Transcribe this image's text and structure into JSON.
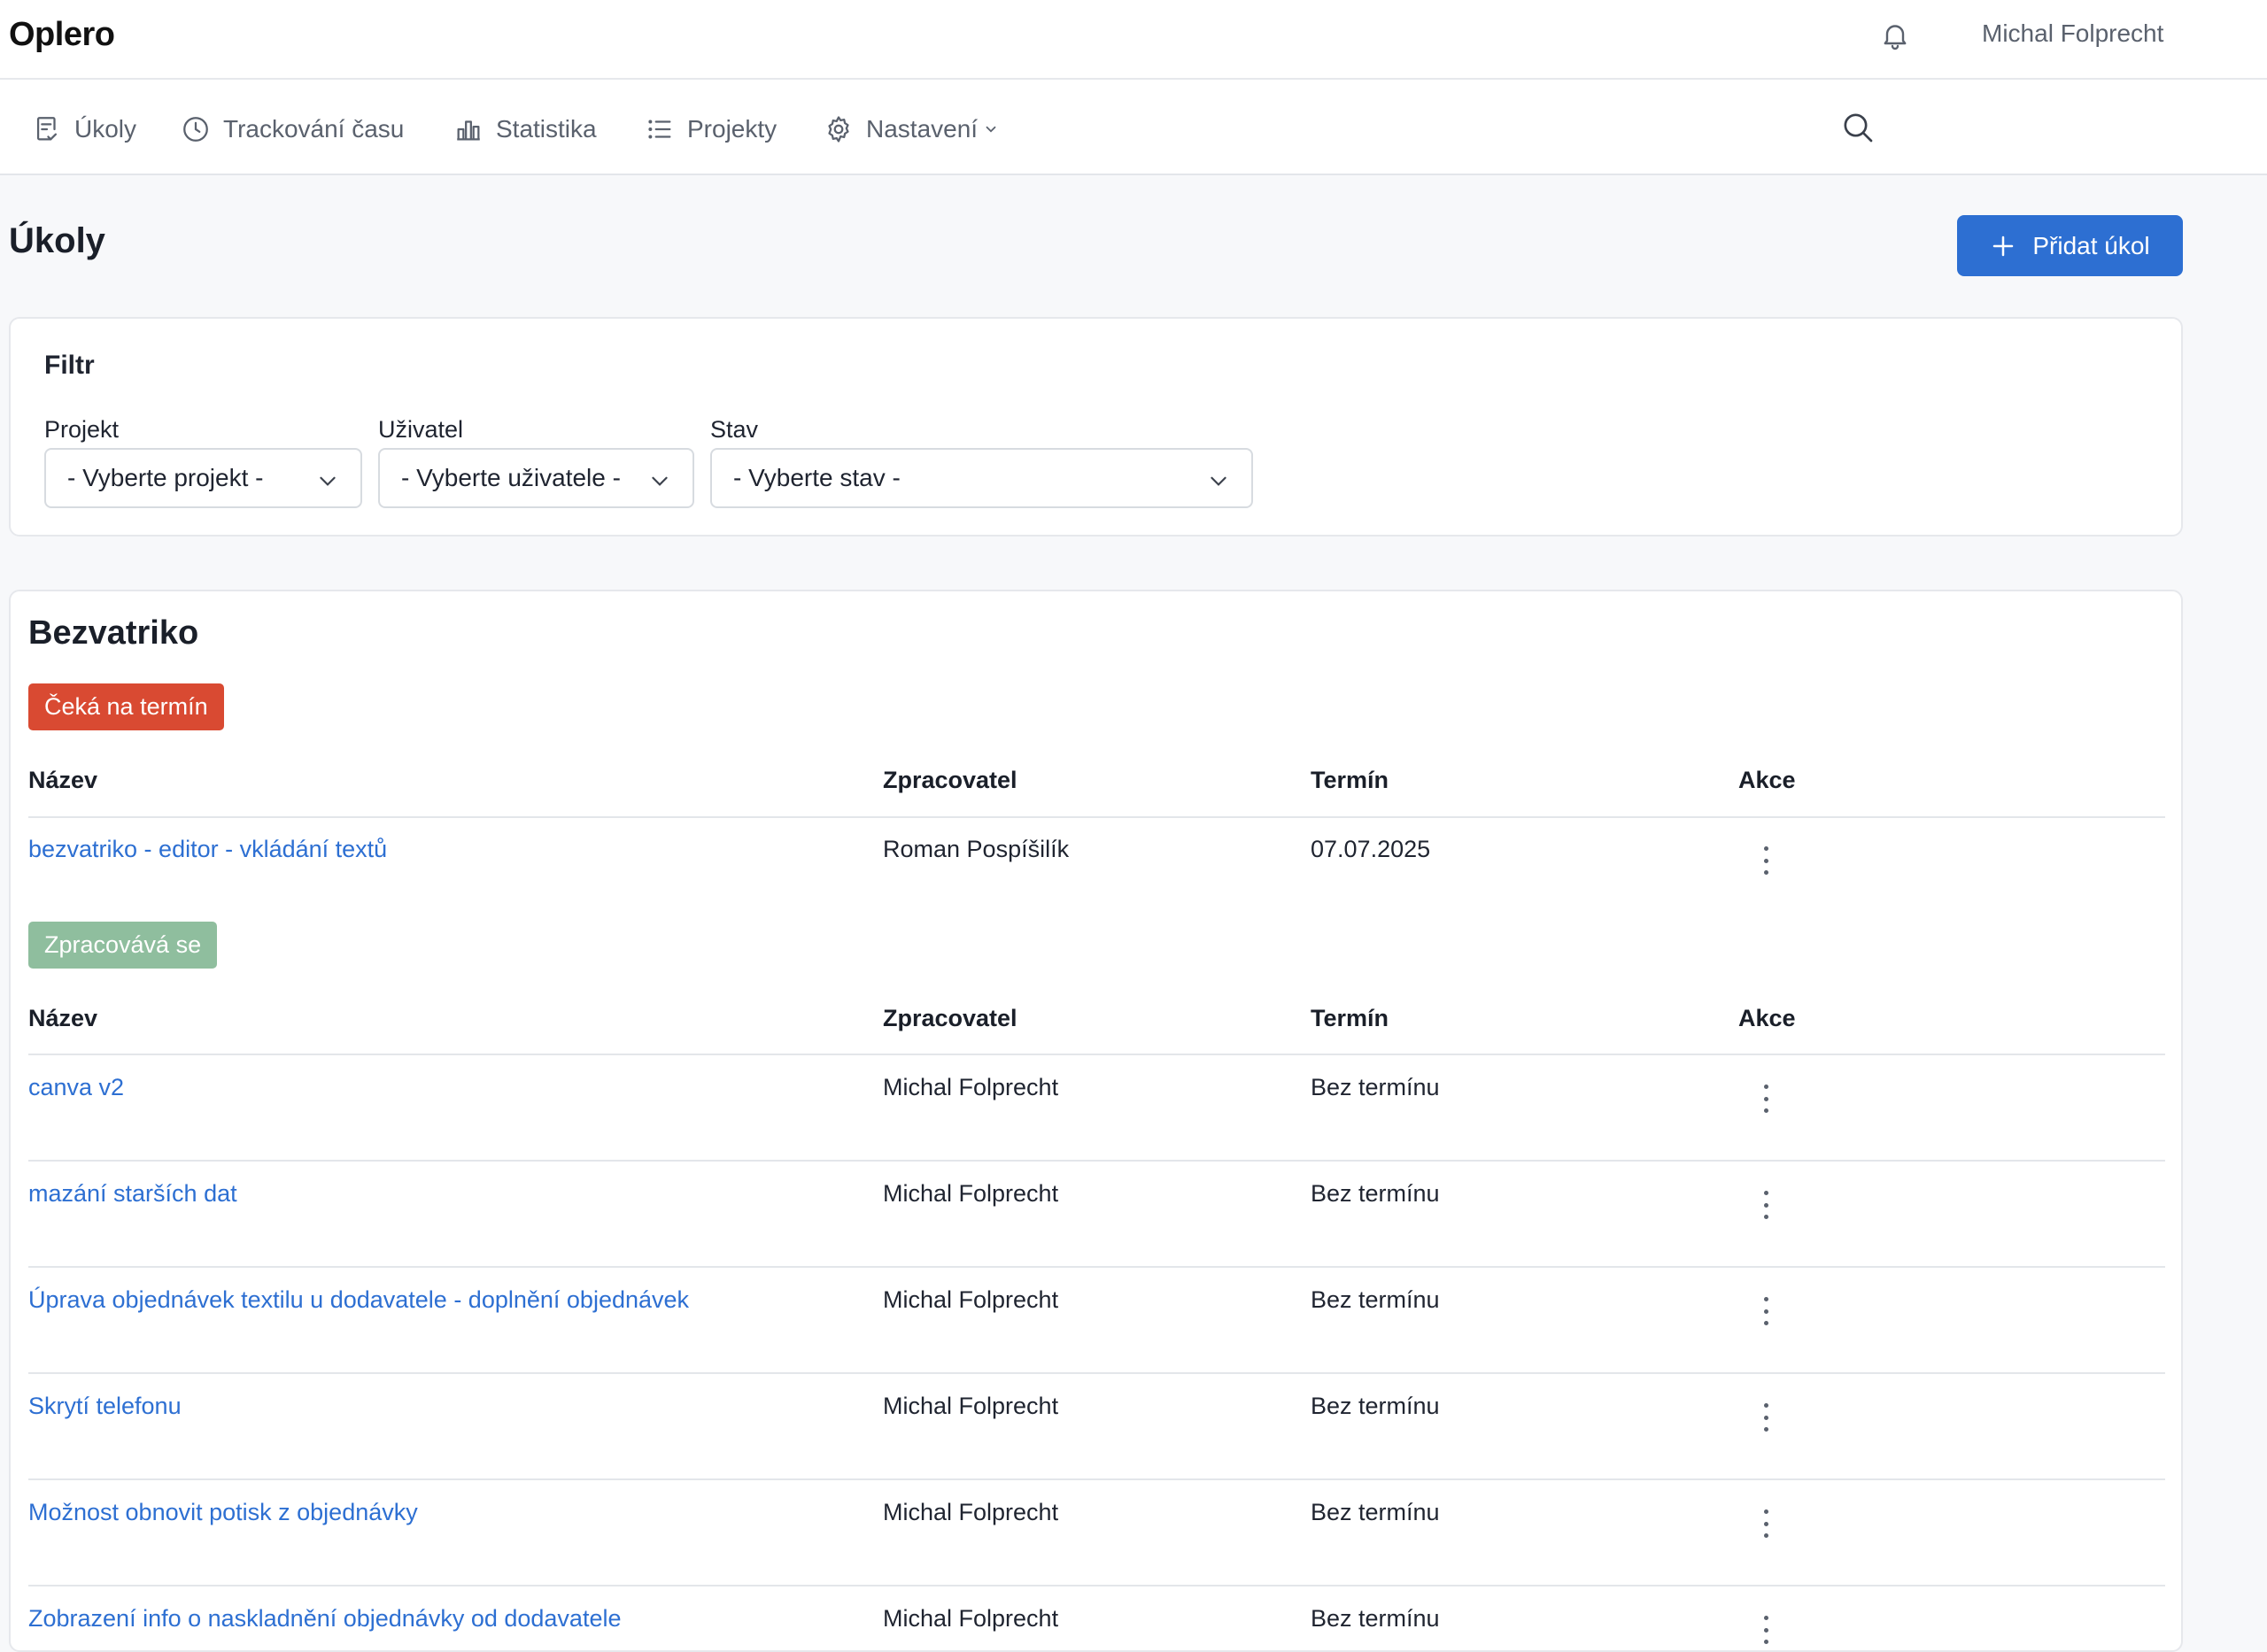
{
  "app": {
    "brand": "Oplero",
    "user_name": "Michal Folprecht"
  },
  "nav": {
    "items": [
      {
        "label": "Úkoly",
        "icon": "task-icon"
      },
      {
        "label": "Trackování času",
        "icon": "clock-icon"
      },
      {
        "label": "Statistika",
        "icon": "bar-chart-icon"
      },
      {
        "label": "Projekty",
        "icon": "list-icon"
      },
      {
        "label": "Nastavení",
        "icon": "gear-icon"
      }
    ]
  },
  "page": {
    "title": "Úkoly",
    "add_button": "Přidat úkol"
  },
  "filter": {
    "title": "Filtr",
    "project": {
      "label": "Projekt",
      "value": "- Vyberte projekt -"
    },
    "user": {
      "label": "Uživatel",
      "value": "- Vyberte uživatele -"
    },
    "status": {
      "label": "Stav",
      "value": "- Vyberte stav -"
    }
  },
  "colors": {
    "accent": "#2d6fd2",
    "badge_waiting": "#d94a32",
    "badge_processing": "#8fbe9e"
  },
  "group": {
    "title": "Bezvatriko",
    "columns": {
      "name": "Název",
      "assignee": "Zpracovatel",
      "deadline": "Termín",
      "actions": "Akce"
    },
    "sections": [
      {
        "status": "Čeká na termín",
        "rows": [
          {
            "name": "bezvatriko - editor - vkládání textů",
            "assignee": "Roman Pospíšilík",
            "deadline": "07.07.2025"
          }
        ]
      },
      {
        "status": "Zpracovává se",
        "rows": [
          {
            "name": "canva v2",
            "assignee": "Michal Folprecht",
            "deadline": "Bez termínu"
          },
          {
            "name": "mazání starších dat",
            "assignee": "Michal Folprecht",
            "deadline": "Bez termínu"
          },
          {
            "name": "Úprava objednávek textilu u dodavatele - doplnění objednávek",
            "assignee": "Michal Folprecht",
            "deadline": "Bez termínu"
          },
          {
            "name": "Skrytí telefonu",
            "assignee": "Michal Folprecht",
            "deadline": "Bez termínu"
          },
          {
            "name": "Možnost obnovit potisk z objednávky",
            "assignee": "Michal Folprecht",
            "deadline": "Bez termínu"
          },
          {
            "name": "Zobrazení info o naskladnění objednávky od dodavatele",
            "assignee": "Michal Folprecht",
            "deadline": "Bez termínu"
          }
        ]
      }
    ]
  }
}
